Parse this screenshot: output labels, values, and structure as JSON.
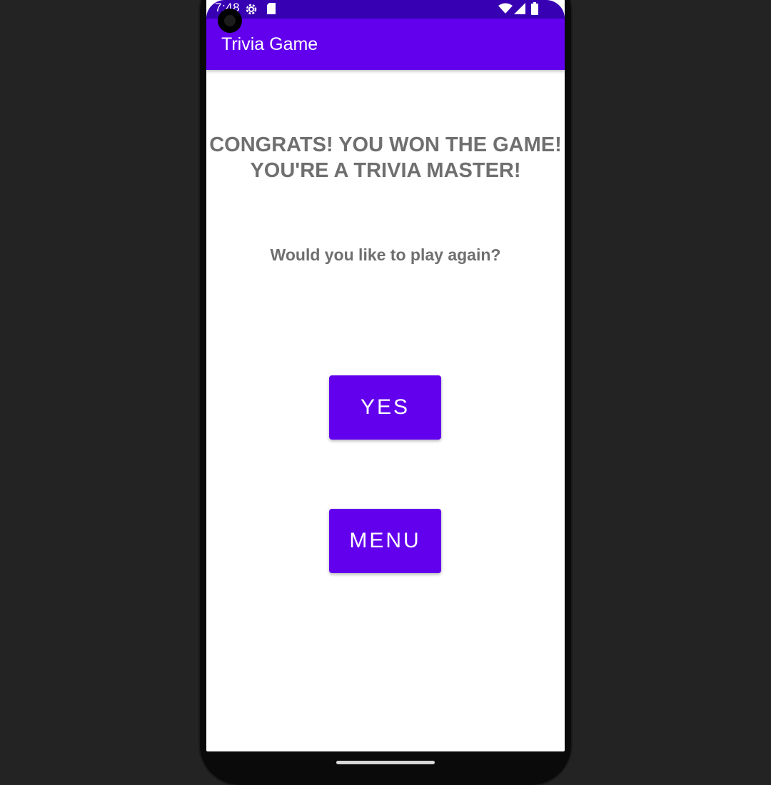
{
  "status_bar": {
    "time": "7:48",
    "icons": [
      "gear-icon",
      "sd-card-icon",
      "wifi-icon",
      "signal-icon",
      "battery-icon"
    ]
  },
  "app_bar": {
    "title": "Trivia Game"
  },
  "main": {
    "congrats_line1": "CONGRATS! YOU WON THE GAME!",
    "congrats_line2": "YOU'RE A TRIVIA MASTER!",
    "prompt": "Would you like to play again?",
    "yes_label": "YES",
    "menu_label": "MENU"
  },
  "colors": {
    "primary": "#6200ee",
    "primary_dark": "#3700b3",
    "text_gray": "#6f6f6f",
    "background": "#ffffff"
  }
}
